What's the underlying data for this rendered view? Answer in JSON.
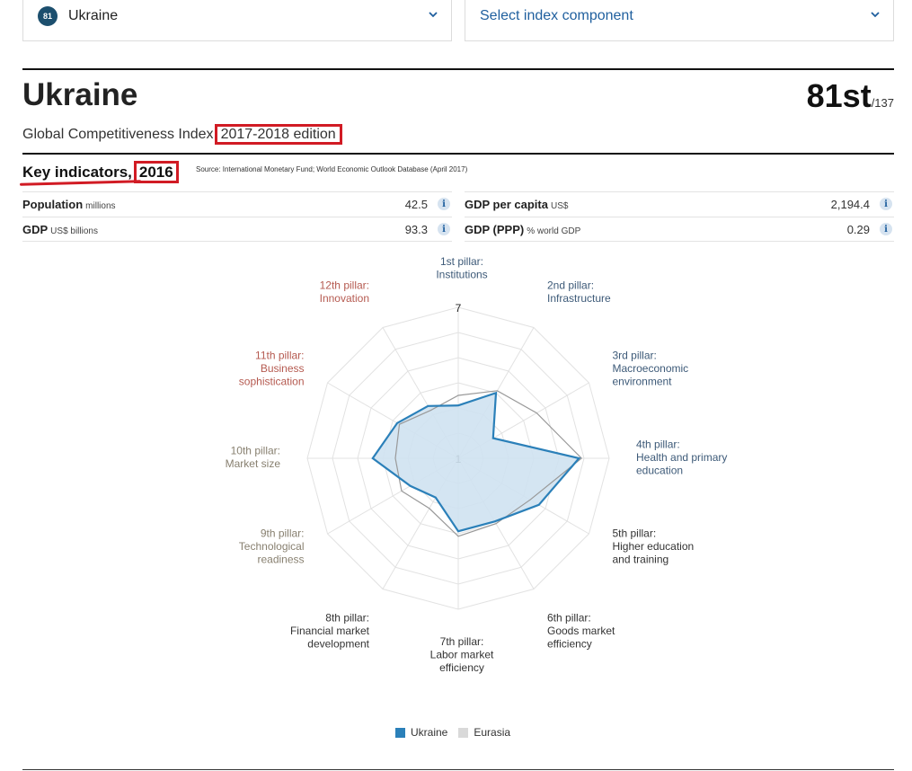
{
  "dropdowns": {
    "country": {
      "badge": "81",
      "label": "Ukraine"
    },
    "component": {
      "label": "Select index component"
    }
  },
  "header": {
    "country": "Ukraine",
    "rank": "81st",
    "rank_total": "/137",
    "index_name": "Global Competitiveness Index",
    "edition": "2017-2018 edition"
  },
  "key_indicators": {
    "title": "Key indicators,",
    "year": "2016",
    "source": "Source: International Monetary Fund; World Economic Outlook Database (April 2017)",
    "rows": [
      {
        "label": "Population",
        "unit": "millions",
        "value": "42.5"
      },
      {
        "label": "GDP per capita",
        "unit": "US$",
        "value": "2,194.4"
      },
      {
        "label": "GDP",
        "unit": "US$ billions",
        "value": "93.3"
      },
      {
        "label": "GDP (PPP)",
        "unit": "% world GDP",
        "value": "0.29"
      }
    ],
    "info_icon": "i"
  },
  "colors": {
    "ukraine": "#2b80b9",
    "ukraine_fill": "#cfe2f1",
    "eurasia": "#999999",
    "eurasia_swatch": "#d9d9d9",
    "red_labels": "#b55a50",
    "blue_labels": "#3d5a78",
    "gray_labels": "#888070",
    "accent_red": "#d11b24"
  },
  "chart_data": {
    "type": "radar",
    "rmin": 1,
    "rmax": 7,
    "scale_labels": [
      "7",
      "1"
    ],
    "axes": [
      {
        "lines": [
          "1st pillar:",
          "Institutions"
        ],
        "group": "blue"
      },
      {
        "lines": [
          "2nd pillar:",
          "Infrastructure"
        ],
        "group": "blue"
      },
      {
        "lines": [
          "3rd pillar:",
          "Macroeconomic",
          "environment"
        ],
        "group": "blue"
      },
      {
        "lines": [
          "4th pillar:",
          "Health and primary",
          "education"
        ],
        "group": "blue"
      },
      {
        "lines": [
          "5th pillar:",
          "Higher education",
          "and training"
        ],
        "group": "dark"
      },
      {
        "lines": [
          "6th pillar:",
          "Goods market",
          "efficiency"
        ],
        "group": "dark"
      },
      {
        "lines": [
          "7th pillar:",
          "Labor market",
          "efficiency"
        ],
        "group": "dark"
      },
      {
        "lines": [
          "8th pillar:",
          "Financial market",
          "development"
        ],
        "group": "dark"
      },
      {
        "lines": [
          "9th pillar:",
          "Technological",
          "readiness"
        ],
        "group": "gray"
      },
      {
        "lines": [
          "10th pillar:",
          "Market size"
        ],
        "group": "gray"
      },
      {
        "lines": [
          "11th pillar:",
          "Business",
          "sophistication"
        ],
        "group": "red"
      },
      {
        "lines": [
          "12th pillar:",
          "Innovation"
        ],
        "group": "red"
      }
    ],
    "series": [
      {
        "name": "Ukraine",
        "values": [
          3.1,
          4.0,
          2.6,
          5.8,
          4.7,
          3.9,
          3.9,
          2.8,
          3.2,
          4.4,
          3.8,
          3.4
        ]
      },
      {
        "name": "Eurasia",
        "values": [
          3.5,
          4.1,
          4.6,
          5.9,
          4.3,
          4.0,
          4.1,
          3.3,
          3.6,
          3.5,
          3.7,
          3.2
        ]
      }
    ],
    "legend": [
      "Ukraine",
      "Eurasia"
    ],
    "legend_position": "bottom"
  }
}
